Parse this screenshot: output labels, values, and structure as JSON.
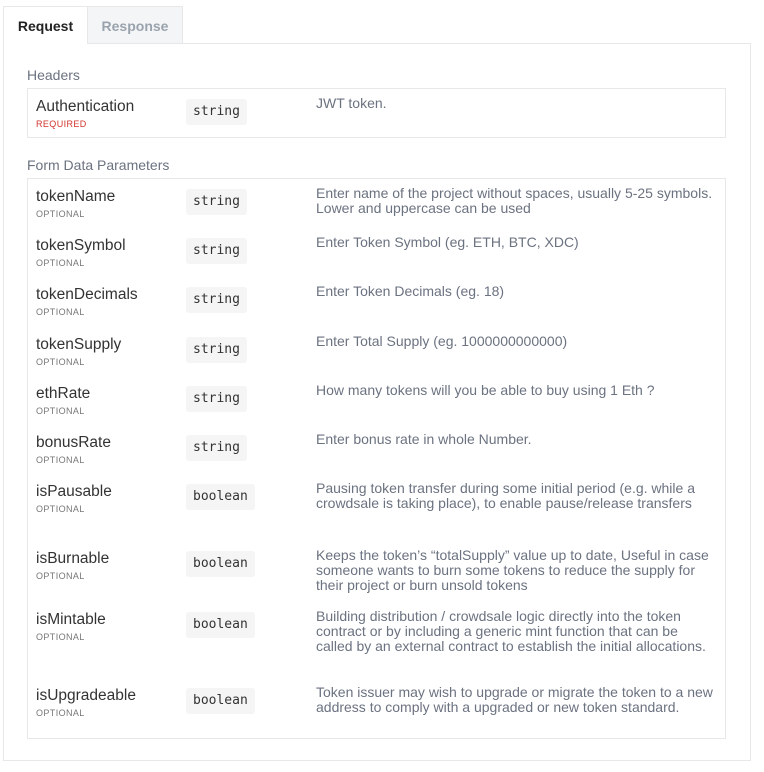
{
  "tabs": [
    {
      "label": "Request",
      "active": true
    },
    {
      "label": "Response",
      "active": false
    }
  ],
  "headers": {
    "title": "Headers",
    "params": [
      {
        "name": "Authentication",
        "tag": "REQUIRED",
        "type": "string",
        "desc": "JWT token."
      }
    ]
  },
  "form": {
    "title": "Form Data Parameters",
    "params": [
      {
        "name": "tokenName",
        "tag": "OPTIONAL",
        "type": "string",
        "desc": "Enter name of the project without spaces, usually 5-25 symbols. Lower and uppercase can be used"
      },
      {
        "name": "tokenSymbol",
        "tag": "OPTIONAL",
        "type": "string",
        "desc": "Enter Token Symbol (eg. ETH, BTC, XDC)"
      },
      {
        "name": "tokenDecimals",
        "tag": "OPTIONAL",
        "type": "string",
        "desc": "Enter Token Decimals (eg. 18)"
      },
      {
        "name": "tokenSupply",
        "tag": "OPTIONAL",
        "type": "string",
        "desc": "Enter Total Supply (eg. 1000000000000)"
      },
      {
        "name": "ethRate",
        "tag": "OPTIONAL",
        "type": "string",
        "desc": "How many tokens will you be able to buy using 1 Eth ?"
      },
      {
        "name": "bonusRate",
        "tag": "OPTIONAL",
        "type": "string",
        "desc": "Enter bonus rate in whole Number."
      },
      {
        "name": "isPausable",
        "tag": "OPTIONAL",
        "type": "boolean",
        "desc": "Pausing token transfer during some initial period (e.g. while a crowdsale is taking place), to enable pause/release transfers"
      },
      {
        "name": "isBurnable",
        "tag": "OPTIONAL",
        "type": "boolean",
        "desc": "Keeps the token’s “totalSupply” value up to date, Useful in case someone wants to burn some tokens to reduce the supply for their project or burn unsold tokens"
      },
      {
        "name": "isMintable",
        "tag": "OPTIONAL",
        "type": "boolean",
        "desc": "Building distribution / crowdsale logic directly into the token contract or by including a generic mint function that can be called by an external contract to establish the initial allocations."
      },
      {
        "name": "isUpgradeable",
        "tag": "OPTIONAL",
        "type": "boolean",
        "desc": "Token issuer may wish to upgrade or migrate the token to a new address to comply with a upgraded or new token standard."
      }
    ]
  }
}
